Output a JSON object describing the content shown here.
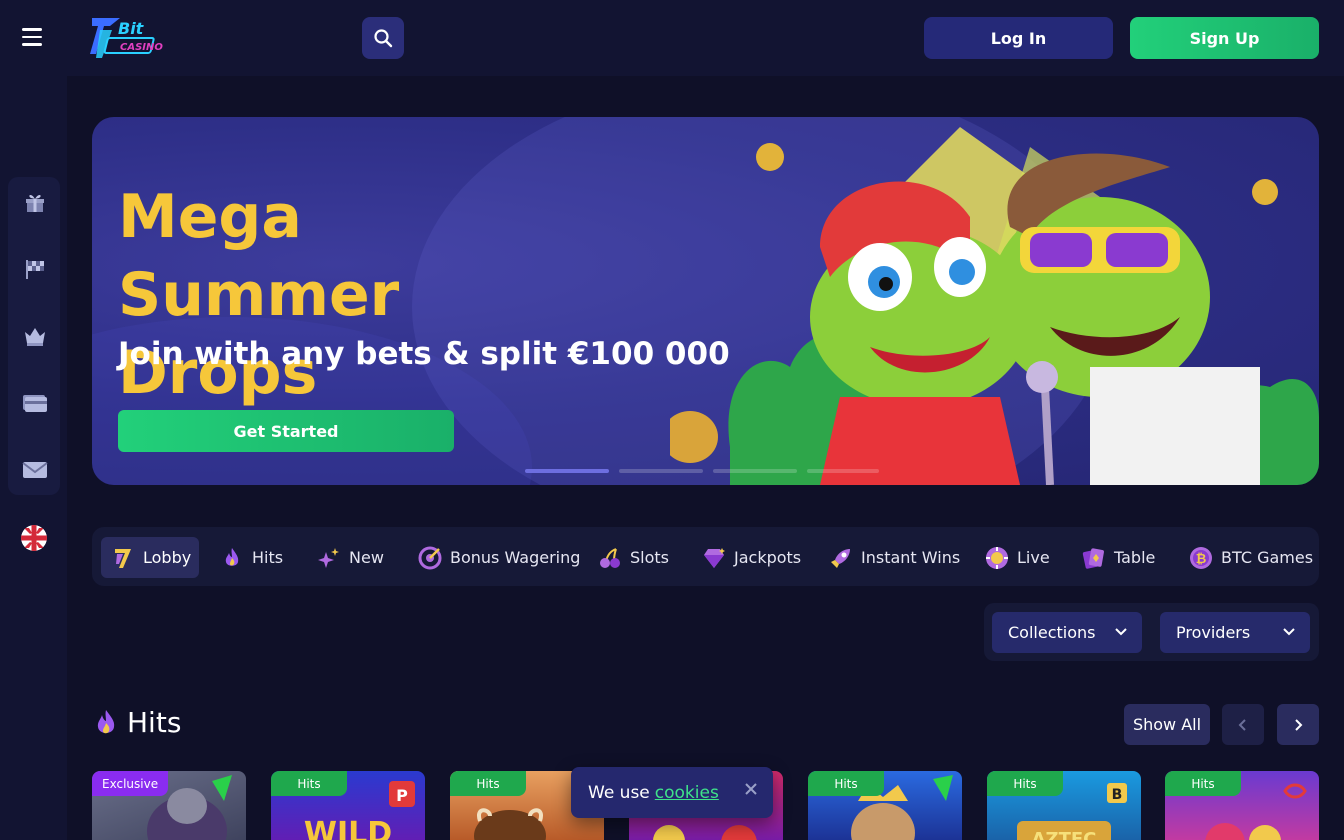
{
  "header": {
    "logo_alt": "7Bit Casino",
    "login_label": "Log In",
    "signup_label": "Sign Up",
    "icons": [
      "menu-icon",
      "search-icon"
    ]
  },
  "sidebar": {
    "items": [
      {
        "icon": "gift-icon"
      },
      {
        "icon": "checkered-flag-icon"
      },
      {
        "icon": "crown-icon"
      },
      {
        "icon": "credit-card-icon"
      },
      {
        "icon": "envelope-icon"
      }
    ],
    "language_icon": "uk-flag-icon"
  },
  "banner": {
    "title": "Mega Summer Drops",
    "subtitle": "Join with any bets & split €100 000",
    "cta_label": "Get Started",
    "slide_count": 4,
    "active_slide": 1
  },
  "categories": [
    {
      "label": "Lobby",
      "icon": "seven-icon",
      "active": true
    },
    {
      "label": "Hits",
      "icon": "flame-icon"
    },
    {
      "label": "New",
      "icon": "sparkles-icon"
    },
    {
      "label": "Bonus Wagering",
      "icon": "target-icon"
    },
    {
      "label": "Slots",
      "icon": "cherries-icon"
    },
    {
      "label": "Jackpots",
      "icon": "diamond-icon"
    },
    {
      "label": "Instant Wins",
      "icon": "rocket-icon"
    },
    {
      "label": "Live",
      "icon": "casino-chip-icon"
    },
    {
      "label": "Table",
      "icon": "cards-icon"
    },
    {
      "label": "BTC Games",
      "icon": "bitcoin-icon"
    }
  ],
  "filters": {
    "collections_label": "Collections",
    "providers_label": "Providers"
  },
  "hits_section": {
    "title": "Hits",
    "show_all_label": "Show All",
    "cards": [
      {
        "tag": "Exclusive",
        "tag_color": "#8a2cf0"
      },
      {
        "tag": "Hits",
        "tag_color": "#1fa84d"
      },
      {
        "tag": "Hits",
        "tag_color": "#1fa84d"
      },
      {
        "tag": "",
        "tag_color": ""
      },
      {
        "tag": "Hits",
        "tag_color": "#1fa84d"
      },
      {
        "tag": "Hits",
        "tag_color": "#1fa84d"
      },
      {
        "tag": "Hits",
        "tag_color": "#1fa84d"
      }
    ]
  },
  "cookie_notice": {
    "text": "We use",
    "link_label": "cookies"
  },
  "colors": {
    "background": "#0f1028",
    "header": "#121432",
    "accent_green": "#22d07a",
    "title_yellow": "#f6c73a",
    "button_blue": "#252978"
  }
}
